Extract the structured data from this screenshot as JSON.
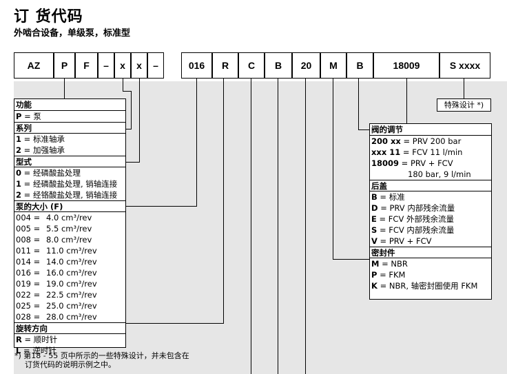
{
  "title": "订 货代码",
  "subtitle": "外啮合设备，单级泵，标准型",
  "code_cells": [
    "AZ",
    "P",
    "F",
    "–",
    "x",
    "x",
    "–",
    "016",
    "R",
    "C",
    "B",
    "20",
    "M",
    "B",
    "18009",
    "S xxxx"
  ],
  "left_panel": {
    "function_header": "功能",
    "function_row_key": "P",
    "function_row_text": " = 泵",
    "series_header": "系列",
    "series_rows": [
      {
        "key": "1",
        "text": " = 标准轴承"
      },
      {
        "key": "2",
        "text": " = 加强轴承"
      }
    ],
    "type_header": "型式",
    "type_rows": [
      {
        "key": "0",
        "text": " = 经磷酸盐处理"
      },
      {
        "key": "1",
        "text": " = 经磷酸盐处理, 销轴连接"
      },
      {
        "key": "2",
        "text": " = 经铬酸盐处理, 销轴连接"
      }
    ],
    "size_header": "泵的大小 (F)",
    "size_rows": [
      {
        "code": "004 =",
        "value": "4.0 cm³/rev"
      },
      {
        "code": "005 =",
        "value": "5.5 cm³/rev"
      },
      {
        "code": "008 =",
        "value": "8.0 cm³/rev"
      },
      {
        "code": "011 =",
        "value": "11.0 cm³/rev"
      },
      {
        "code": "014 =",
        "value": "14.0 cm³/rev"
      },
      {
        "code": "016 =",
        "value": "16.0 cm³/rev"
      },
      {
        "code": "019 =",
        "value": "19.0 cm³/rev"
      },
      {
        "code": "022 =",
        "value": "22.5 cm³/rev"
      },
      {
        "code": "025 =",
        "value": "25.0 cm³/rev"
      },
      {
        "code": "028 =",
        "value": "28.0 cm³/rev"
      }
    ],
    "rotation_header": "旋转方向",
    "rotation_rows": [
      {
        "key": "R",
        "text": " = 顺时针"
      },
      {
        "key": "L",
        "text": " = 逆时针"
      }
    ]
  },
  "right_panel": {
    "valve_header": "阀的调节",
    "valve_rows": [
      {
        "key": "200 xx",
        "text": " = PRV 200 bar"
      },
      {
        "key": "xxx 11",
        "text": " = FCV 11 l/min"
      },
      {
        "key": "18009",
        "text": " = PRV + FCV"
      },
      {
        "key": "",
        "text": "180 bar, 9 l/min"
      }
    ],
    "cover_header": "后盖",
    "cover_rows": [
      {
        "key": "B",
        "text": " = 标准"
      },
      {
        "key": "D",
        "text": " = PRV 内部残余流量"
      },
      {
        "key": "E",
        "text": " = FCV 外部残余流量"
      },
      {
        "key": "S",
        "text": " = FCV 内部残余流量"
      },
      {
        "key": "V",
        "text": " = PRV + FCV"
      }
    ],
    "seal_header": "密封件",
    "seal_rows": [
      {
        "key": "M",
        "text": " = NBR"
      },
      {
        "key": "P",
        "text": " = FKM"
      },
      {
        "key": "K",
        "text": " = NBR, 轴密封圈使用 FKM"
      }
    ]
  },
  "special_design": "特殊设计 *)",
  "footnote_line1": "*) 第18 - 55 页中所示的一些特殊设计，并未包含在",
  "footnote_line2": "订货代码的说明示例之中。"
}
